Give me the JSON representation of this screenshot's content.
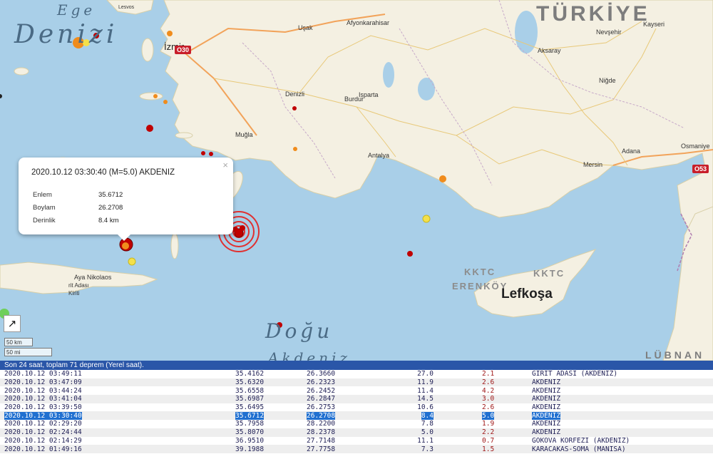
{
  "map": {
    "country_label": "TÜRKİYE",
    "country_label_east": "LÜBNAN",
    "sea_labels": {
      "ege_1": "Ege",
      "ege_2": "Denizi",
      "akdeniz_1": "Doğu",
      "akdeniz_2": "Akdeniz"
    },
    "cities": {
      "izmir": "İzmir",
      "usak": "Uşak",
      "afyonkarahisar": "Afyonkarahisar",
      "nevsehir": "Nevşehir",
      "kayseri": "Kayseri",
      "aksaray": "Aksaray",
      "nigde": "Niğde",
      "denizli": "Denizli",
      "burdur": "Burdur",
      "isparta": "Isparta",
      "mugla": "Muğla",
      "antalya": "Antalya",
      "adana": "Adana",
      "osmaniye": "Osmaniye",
      "mersin": "Mersin",
      "lesvos": "Lesvos",
      "aya_nikolaos": "Aya Nikolaos",
      "kritiki": "Kiriti",
      "adasi": "rit Adası"
    },
    "kktc_1": "KKTC",
    "kktc_2": "KKTC",
    "erenkoy": "ERENKÖY",
    "lefkosa": "Lefkoşa",
    "shields": {
      "o30": "O30",
      "o53": "O53"
    },
    "scale": {
      "km": "50 km",
      "mi": "50 mi"
    },
    "colors": {
      "sea": "#a9cfe8",
      "land": "#f4f0e2",
      "recent": "#c00000",
      "older": "#f08c1c",
      "oldest": "#f4e04a"
    }
  },
  "popup": {
    "title": "2020.10.12 03:30:40 (M=5.0) AKDENIZ",
    "close": "×",
    "lat_label": "Enlem",
    "lat_value": "35.6712",
    "lon_label": "Boylam",
    "lon_value": "26.2708",
    "depth_label": "Derinlik",
    "depth_value": "8.4 km"
  },
  "panel": {
    "title": "Son 24 saat, toplam 71 deprem (Yerel saat).",
    "rows": [
      {
        "date": "2020.10.12 03:49:11",
        "lat": "35.4162",
        "lon": "26.3660",
        "depth": "27.0",
        "mag": "2.1",
        "loc": "GIRIT ADASI (AKDENIZ)"
      },
      {
        "date": "2020.10.12 03:47:09",
        "lat": "35.6320",
        "lon": "26.2323",
        "depth": "11.9",
        "mag": "2.6",
        "loc": "AKDENIZ"
      },
      {
        "date": "2020.10.12 03:44:24",
        "lat": "35.6558",
        "lon": "26.2452",
        "depth": "11.4",
        "mag": "4.2",
        "loc": "AKDENIZ"
      },
      {
        "date": "2020.10.12 03:41:04",
        "lat": "35.6987",
        "lon": "26.2847",
        "depth": "14.5",
        "mag": "3.0",
        "loc": "AKDENIZ"
      },
      {
        "date": "2020.10.12 03:39:50",
        "lat": "35.6495",
        "lon": "26.2753",
        "depth": "10.6",
        "mag": "2.6",
        "loc": "AKDENIZ"
      },
      {
        "date": "2020.10.12 03:30:40",
        "lat": "35.6712",
        "lon": "26.2708",
        "depth": "8.4",
        "mag": "5.0",
        "loc": "AKDENIZ"
      },
      {
        "date": "2020.10.12 02:29:20",
        "lat": "35.7958",
        "lon": "28.2200",
        "depth": "7.8",
        "mag": "1.9",
        "loc": "AKDENIZ"
      },
      {
        "date": "2020.10.12 02:24:44",
        "lat": "35.8070",
        "lon": "28.2378",
        "depth": "5.0",
        "mag": "2.2",
        "loc": "AKDENIZ"
      },
      {
        "date": "2020.10.12 02:14:29",
        "lat": "36.9510",
        "lon": "27.7148",
        "depth": "11.1",
        "mag": "0.7",
        "loc": "GOKOVA KORFEZI (AKDENIZ)"
      },
      {
        "date": "2020.10.12 01:49:16",
        "lat": "39.1988",
        "lon": "27.7758",
        "depth": "7.3",
        "mag": "1.5",
        "loc": "KARACAKAS-SOMA (MANISA)"
      }
    ]
  }
}
